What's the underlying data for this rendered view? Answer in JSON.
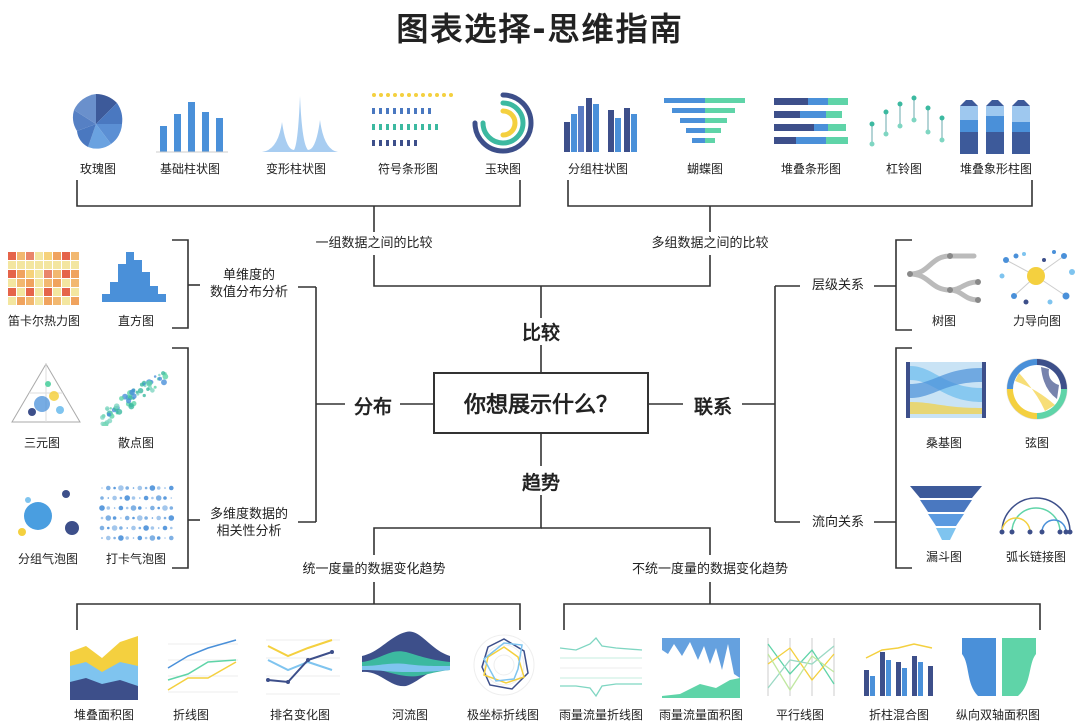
{
  "title": "图表选择-思维指南",
  "center": "你想展示什么？",
  "branches": {
    "compare": "比较",
    "distribution": "分布",
    "relation": "联系",
    "trend": "趋势"
  },
  "sub": {
    "one_group": "一组数据之间的比较",
    "multi_group": "多组数据之间的比较",
    "single_dim": [
      "单维度的",
      "数值分布分析"
    ],
    "multi_dim": [
      "多维度数据的",
      "相关性分析"
    ],
    "hierarchy": "层级关系",
    "flow": "流向关系",
    "unified": "统一度量的数据变化趋势",
    "non_unified": "不统一度量的数据变化趋势"
  },
  "labels": {
    "rose": "玫瑰图",
    "basic_bar": "基础柱状图",
    "morph_bar": "变形柱状图",
    "symbol_bar": "符号条形图",
    "jade": "玉玦图",
    "group_bar": "分组柱状图",
    "butterfly": "蝴蝶图",
    "stack_bar": "堆叠条形图",
    "dumbbell": "杠铃图",
    "stack_pictorial": "堆叠象形柱图",
    "heatmap": "笛卡尔热力图",
    "histogram": "直方图",
    "ternary": "三元图",
    "scatter": "散点图",
    "group_bubble": "分组气泡图",
    "punch_bubble": "打卡气泡图",
    "tree": "树图",
    "force": "力导向图",
    "sankey": "桑基图",
    "chord": "弦图",
    "funnel": "漏斗图",
    "arc": "弧长链接图",
    "stack_area": "堆叠面积图",
    "line": "折线图",
    "rank": "排名变化图",
    "stream": "河流图",
    "polar_line": "极坐标折线图",
    "rain_line": "雨量流量折线图",
    "rain_area": "雨量流量面积图",
    "parallel": "平行线图",
    "mixed": "折柱混合图",
    "dual_area": "纵向双轴面积图"
  },
  "colors": {
    "blue": "#4a90d9",
    "navy": "#3d4f8a",
    "green": "#5fd4a8",
    "yellow": "#f4d03f",
    "line": "#333333"
  }
}
